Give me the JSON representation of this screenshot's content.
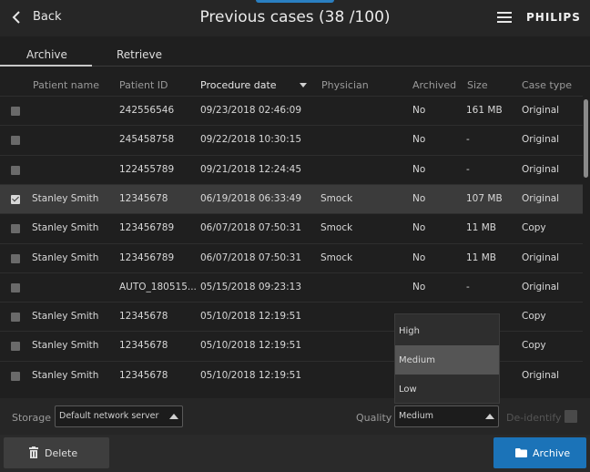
{
  "header": {
    "back_label": "Back",
    "title": "Previous cases (38 /100)",
    "brand": "PHILIPS"
  },
  "tabs": [
    {
      "label": "Archive",
      "active": true
    },
    {
      "label": "Retrieve",
      "active": false
    }
  ],
  "table": {
    "columns": [
      "Patient name",
      "Patient ID",
      "Procedure date",
      "Physician",
      "Archived",
      "Size",
      "Case type"
    ],
    "sorted_column": "Procedure date",
    "rows": [
      {
        "checked": false,
        "name": "",
        "id": "242556546",
        "date": "09/23/2018 02:46:09",
        "physician": "",
        "archived": "No",
        "size": "161 MB",
        "type": "Original"
      },
      {
        "checked": false,
        "name": "",
        "id": "245458758",
        "date": "09/22/2018 10:30:15",
        "physician": "",
        "archived": "No",
        "size": "-",
        "type": "Original"
      },
      {
        "checked": false,
        "name": "",
        "id": "122455789",
        "date": "09/21/2018 12:24:45",
        "physician": "",
        "archived": "No",
        "size": "-",
        "type": "Original"
      },
      {
        "checked": true,
        "name": "Stanley Smith",
        "id": "12345678",
        "date": "06/19/2018 06:33:49",
        "physician": "Smock",
        "archived": "No",
        "size": "107 MB",
        "type": "Original"
      },
      {
        "checked": false,
        "name": "Stanley Smith",
        "id": "123456789",
        "date": "06/07/2018 07:50:31",
        "physician": "Smock",
        "archived": "No",
        "size": "11 MB",
        "type": "Copy"
      },
      {
        "checked": false,
        "name": "Stanley Smith",
        "id": "123456789",
        "date": "06/07/2018 07:50:31",
        "physician": "Smock",
        "archived": "No",
        "size": "11 MB",
        "type": "Original"
      },
      {
        "checked": false,
        "name": "",
        "id": "AUTO_180515...",
        "date": "05/15/2018 09:23:13",
        "physician": "",
        "archived": "No",
        "size": "-",
        "type": "Original"
      },
      {
        "checked": false,
        "name": "Stanley Smith",
        "id": "12345678",
        "date": "05/10/2018 12:19:51",
        "physician": "",
        "archived": "",
        "size": "",
        "type": "Copy"
      },
      {
        "checked": false,
        "name": "Stanley Smith",
        "id": "12345678",
        "date": "05/10/2018 12:19:51",
        "physician": "",
        "archived": "",
        "size": "",
        "type": "Copy"
      },
      {
        "checked": false,
        "name": "Stanley Smith",
        "id": "12345678",
        "date": "05/10/2018 12:19:51",
        "physician": "",
        "archived": "",
        "size": "",
        "type": "Original"
      }
    ]
  },
  "storage": {
    "label": "Storage",
    "value": "Default network server",
    "quality_label": "Quality",
    "quality_value": "Medium",
    "quality_options": [
      "High",
      "Medium",
      "Low"
    ],
    "quality_highlighted": "Medium",
    "deidentify_label": "De-identify",
    "deidentify_checked": false
  },
  "footer": {
    "delete_label": "Delete",
    "archive_label": "Archive"
  },
  "colors": {
    "accent": "#1b73b8",
    "background": "#1f1f1f",
    "selected_row": "#3b3b3b"
  }
}
